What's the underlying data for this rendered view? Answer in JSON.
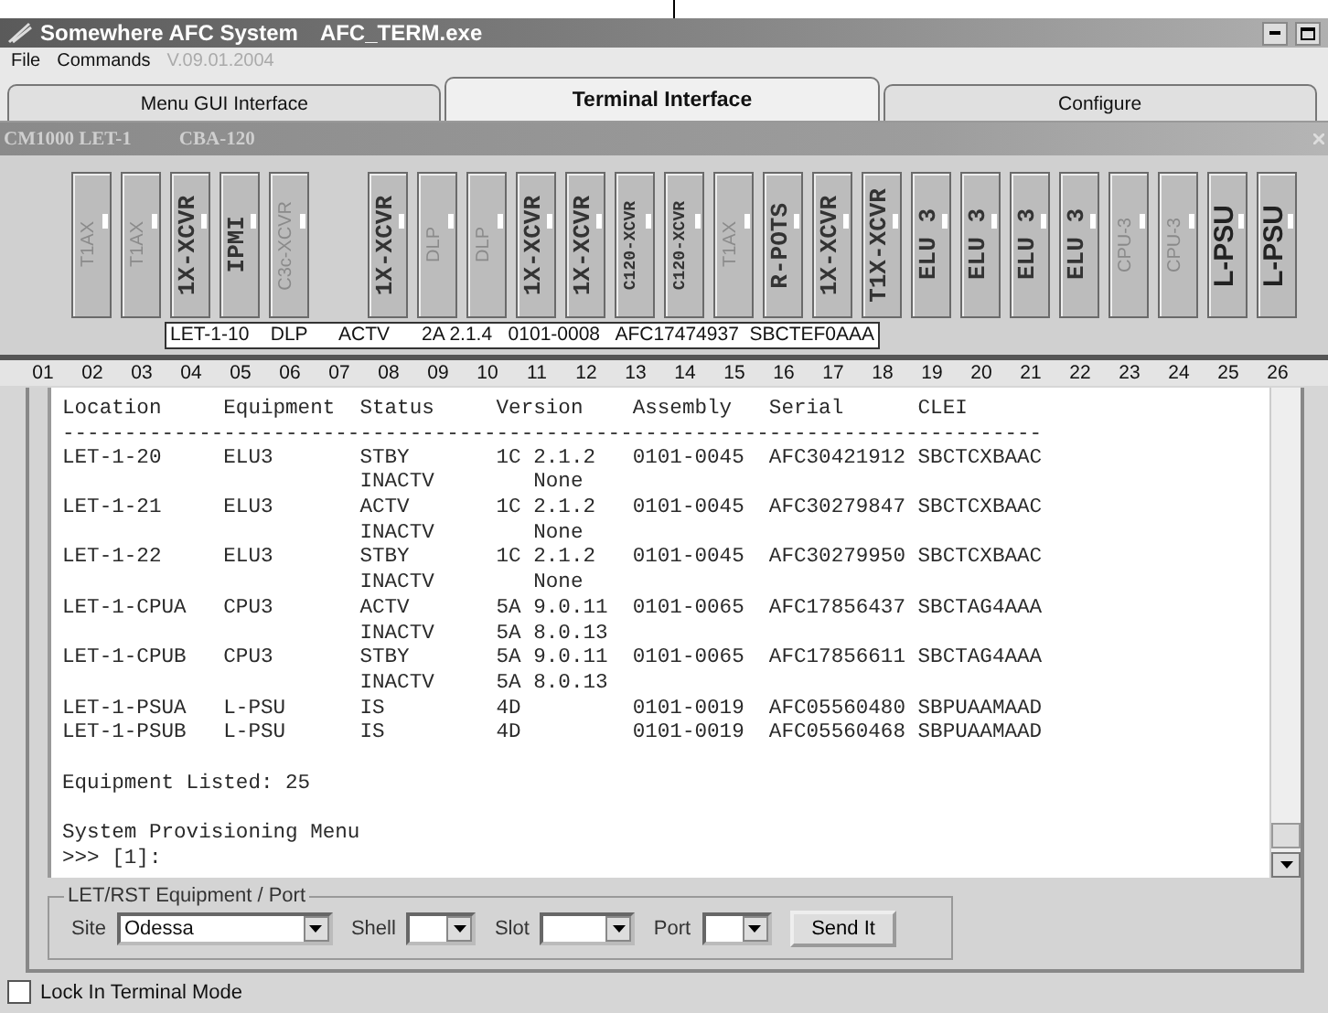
{
  "window": {
    "title": "Somewhere AFC System",
    "subtitle": "AFC_TERM.exe"
  },
  "menu": [
    {
      "label": "File",
      "disabled": false
    },
    {
      "label": "Commands",
      "disabled": false
    },
    {
      "label": "V.09.01.2004",
      "disabled": true
    }
  ],
  "tabs": [
    {
      "label": "Menu GUI Interface",
      "selected": false
    },
    {
      "label": "Terminal Interface",
      "selected": true
    },
    {
      "label": "Configure",
      "selected": false
    }
  ],
  "rack": {
    "name": "CM1000 LET-1",
    "type": "CBA-120",
    "cards": [
      {
        "kind": "empty"
      },
      {
        "kind": "faint",
        "label": "T1AX"
      },
      {
        "kind": "faint",
        "label": "T1AX"
      },
      {
        "kind": "mono",
        "label": "1X-XCVR"
      },
      {
        "kind": "mono",
        "label": "IPMI"
      },
      {
        "kind": "faint",
        "label": "C3c-XCVR"
      },
      {
        "kind": "empty"
      },
      {
        "kind": "mono",
        "label": "1X-XCVR"
      },
      {
        "kind": "faint",
        "label": "DLP"
      },
      {
        "kind": "faint",
        "label": "DLP"
      },
      {
        "kind": "mono",
        "label": "1X-XCVR"
      },
      {
        "kind": "mono",
        "label": "1X-XCVR"
      },
      {
        "kind": "small",
        "label": "C120-XCVR"
      },
      {
        "kind": "small",
        "label": "C120-XCVR"
      },
      {
        "kind": "faint",
        "label": "T1AX"
      },
      {
        "kind": "mono",
        "label": "R-POTS"
      },
      {
        "kind": "mono",
        "label": "1X-XCVR"
      },
      {
        "kind": "mono",
        "label": "T1X-XCVR"
      },
      {
        "kind": "mono",
        "label": "ELU 3"
      },
      {
        "kind": "mono",
        "label": "ELU 3"
      },
      {
        "kind": "mono",
        "label": "ELU 3"
      },
      {
        "kind": "mono",
        "label": "ELU 3"
      },
      {
        "kind": "faint",
        "label": "CPU-3"
      },
      {
        "kind": "faint",
        "label": "CPU-3"
      },
      {
        "kind": "heavy",
        "label": "L-PSU"
      },
      {
        "kind": "heavy",
        "label": "L-PSU"
      }
    ],
    "tooltip": "LET-1-10    DLP      ACTV      2A 2.1.4   0101-0008   AFC17474937  SBCTEF0AAA",
    "slot_numbers": [
      "01",
      "02",
      "03",
      "04",
      "05",
      "06",
      "07",
      "08",
      "09",
      "10",
      "11",
      "12",
      "13",
      "14",
      "15",
      "16",
      "17",
      "18",
      "19",
      "20",
      "21",
      "22",
      "23",
      "24",
      "25",
      "26"
    ]
  },
  "terminal": {
    "header": "Location     Equipment  Status     Version    Assembly   Serial      CLEI",
    "rule": "-------------------------------------------------------------------------------",
    "rows": [
      "LET-1-20     ELU3       STBY       1C 2.1.2   0101-0045  AFC30421912 SBCTCXBAAC",
      "                        INACTV        None",
      "LET-1-21     ELU3       ACTV       1C 2.1.2   0101-0045  AFC30279847 SBCTCXBAAC",
      "                        INACTV        None",
      "LET-1-22     ELU3       STBY       1C 2.1.2   0101-0045  AFC30279950 SBCTCXBAAC",
      "                        INACTV        None",
      "LET-1-CPUA   CPU3       ACTV       5A 9.0.11  0101-0065  AFC17856437 SBCTAG4AAA",
      "                        INACTV     5A 8.0.13",
      "LET-1-CPUB   CPU3       STBY       5A 9.0.11  0101-0065  AFC17856611 SBCTAG4AAA",
      "                        INACTV     5A 8.0.13",
      "LET-1-PSUA   L-PSU      IS         4D         0101-0019  AFC05560480 SBPUAAMAAD",
      "LET-1-PSUB   L-PSU      IS         4D         0101-0019  AFC05560468 SBPUAAMAAD"
    ],
    "summary": "Equipment Listed: 25",
    "menu_title": "System Provisioning Menu",
    "prompt": ">>> [1]:"
  },
  "port_group": {
    "title": "LET/RST Equipment / Port",
    "fields": [
      {
        "label": "Site",
        "value": "Odessa"
      },
      {
        "label": "Shell"
      },
      {
        "label": "Slot"
      },
      {
        "label": "Port"
      }
    ],
    "button": "Send It"
  },
  "lock_mode": {
    "label": "Lock In Terminal Mode",
    "checked": false
  }
}
